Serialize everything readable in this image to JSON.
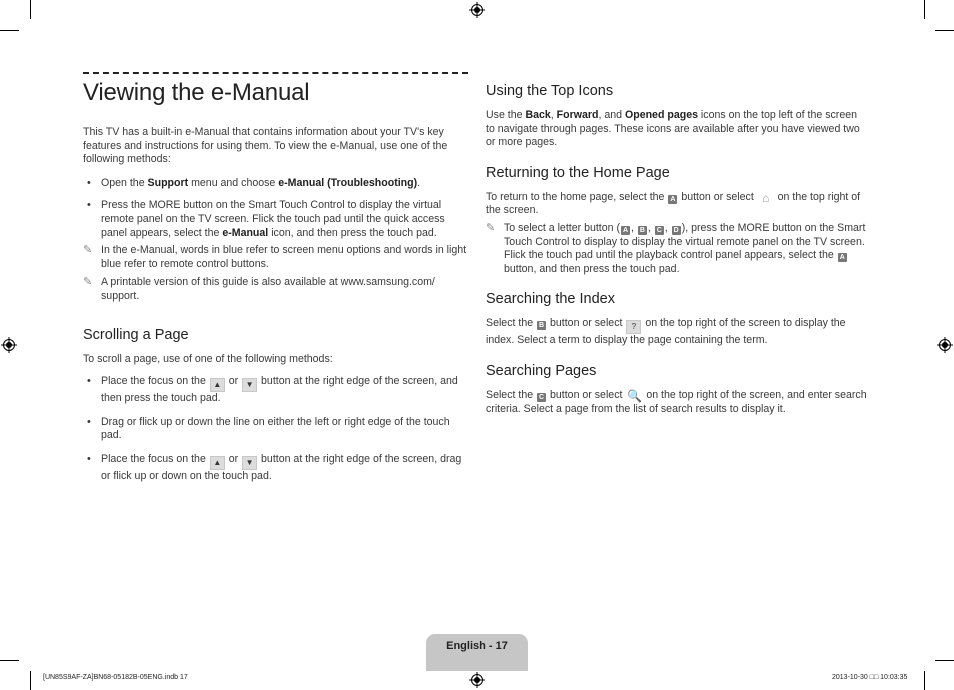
{
  "page": {
    "title": "Viewing the e-Manual",
    "intro": "This TV has a built-in e-Manual that contains information about your TV's key features and instructions for using them. To view the e-Manual, use one of the following methods:",
    "methods": [
      {
        "pre": "Open the ",
        "b1": "Support",
        "mid": " menu and choose ",
        "b2": "e-Manual (Troubleshooting)",
        "post": "."
      },
      {
        "pre": "Press the MORE button on the Smart Touch Control to display the virtual remote panel on the TV screen. Flick the touch pad until the quick access panel appears, select the ",
        "b1": "e-Manual",
        "post": " icon, and then press the touch pad."
      }
    ],
    "notes": [
      "In the e-Manual, words in blue refer to screen menu options and words in light blue refer to remote control buttons.",
      "A printable version of this guide is also available at www.samsung.com/ support."
    ],
    "note_icon": "pencil-note-icon"
  },
  "scrolling": {
    "heading": "Scrolling a Page",
    "intro": "To scroll a page, use of one of the following methods:",
    "items": [
      {
        "pre": "Place the focus on the ",
        "or": " or ",
        "post": " button at the right edge of the screen, and then press the touch pad."
      },
      {
        "text": "Drag or flick up or down the line on either the left or right edge of the touch pad."
      },
      {
        "pre": "Place the focus on the ",
        "or": " or ",
        "post": " button at the right edge of the screen, drag or flick up or down on the touch pad."
      }
    ],
    "up_icon": "▲",
    "down_icon": "▼"
  },
  "top_icons": {
    "heading": "Using the Top Icons",
    "t1": "Use the ",
    "b1": "Back",
    "t2": ", ",
    "b2": "Forward",
    "t3": ", and ",
    "b3": "Opened pages",
    "t4": " icons on the top left of the screen to navigate through pages. These icons are available after you have viewed two or more pages."
  },
  "home": {
    "heading": "Returning to the Home Page",
    "t1": "To return to the home page, select the ",
    "t2": " button or select ",
    "t3": " on the top right of the screen.",
    "note_t1": "To select a letter button (",
    "note_t2": "), press the MORE button on the Smart Touch Control to display to display the virtual remote panel on the TV screen. Flick the touch pad until the playback control panel appears, select the ",
    "note_t3": " button, and then press the touch pad.",
    "sep": ", ",
    "letters": [
      "A",
      "B",
      "C",
      "D"
    ],
    "home_icon": "⌂"
  },
  "index": {
    "heading": "Searching the Index",
    "t1": "Select the ",
    "t2": " button or select ",
    "t3": " on the top right of the screen to display the index. Select a term to display the page containing the term.",
    "index_icon": "?"
  },
  "search": {
    "heading": "Searching Pages",
    "t1": "Select the ",
    "t2": " button or select ",
    "t3": " on the top right of the screen, and enter search criteria. Select a page from the list of search results to display it.",
    "search_icon": "🔍"
  },
  "footer": {
    "page_label": "English - 17",
    "file_info": "[UN85S9AF-ZA]BN68-05182B-05ENG.indb   17",
    "timestamp": "2013-10-30   □□ 10:03:35"
  }
}
